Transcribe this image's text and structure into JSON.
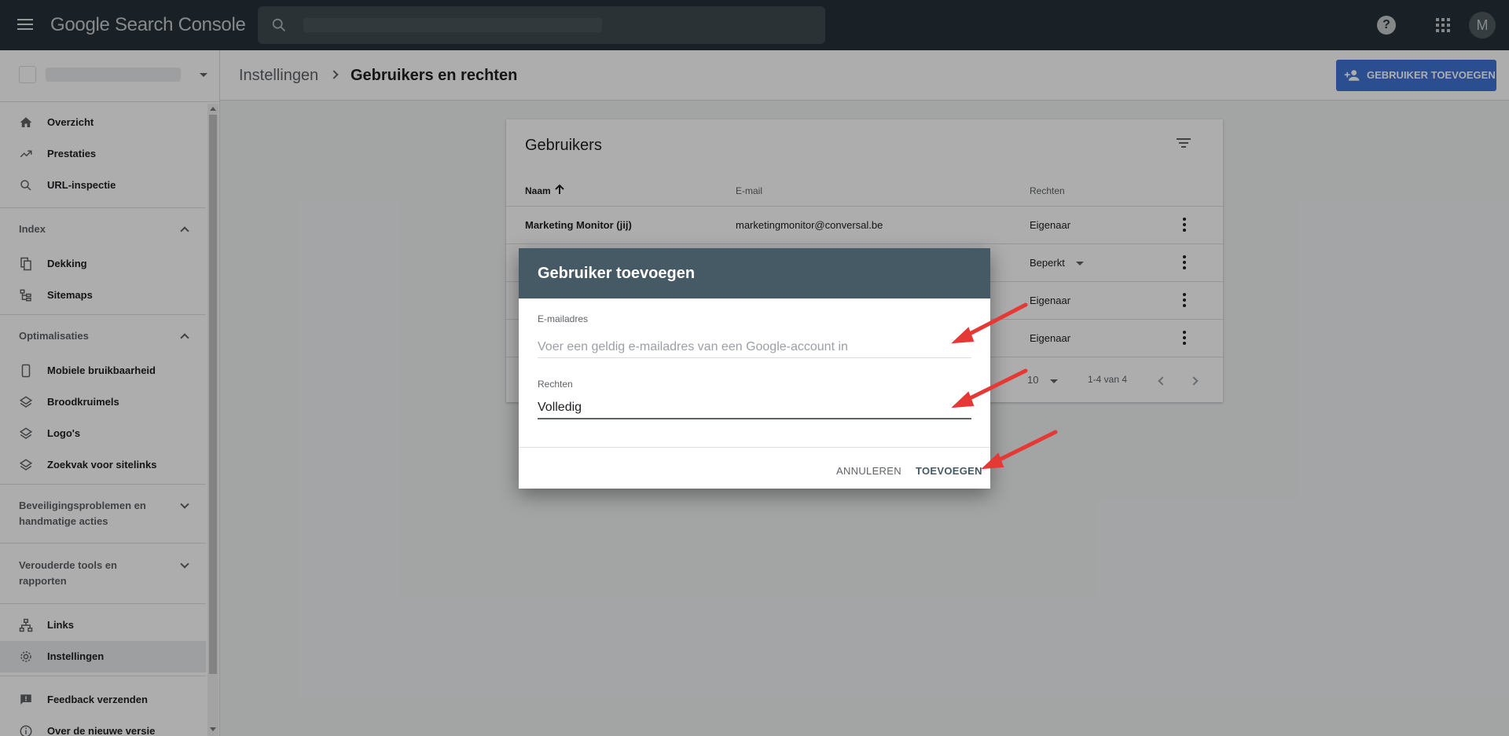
{
  "app": {
    "title": "Google Search Console",
    "avatar_letter": "M",
    "search_placeholder": ""
  },
  "sidebar": {
    "nav_top": [
      {
        "label": "Overzicht",
        "icon": "home-icon"
      },
      {
        "label": "Prestaties",
        "icon": "trending-up-icon"
      },
      {
        "label": "URL-inspectie",
        "icon": "search-icon"
      }
    ],
    "section_index": {
      "label": "Index",
      "items": [
        {
          "label": "Dekking",
          "icon": "copy-pages-icon"
        },
        {
          "label": "Sitemaps",
          "icon": "sitemap-icon"
        }
      ]
    },
    "section_opt": {
      "label": "Optimalisaties",
      "items": [
        {
          "label": "Mobiele bruikbaarheid",
          "icon": "phone-icon"
        },
        {
          "label": "Broodkruimels",
          "icon": "layers-icon"
        },
        {
          "label": "Logo's",
          "icon": "layers-icon"
        },
        {
          "label": "Zoekvak voor sitelinks",
          "icon": "layers-icon"
        }
      ]
    },
    "section_security": {
      "line1": "Beveiligingsproblemen en",
      "line2": "handmatige acties"
    },
    "section_legacy": {
      "line1": "Verouderde tools en",
      "line2": "rapporten"
    },
    "nav_bottom": [
      {
        "label": "Links",
        "icon": "links-icon"
      },
      {
        "label": "Instellingen",
        "icon": "gear-icon",
        "active": true
      }
    ],
    "nav_footer": [
      {
        "label": "Feedback verzenden",
        "icon": "feedback-icon"
      },
      {
        "label": "Over de nieuwe versie",
        "icon": "info-icon"
      }
    ]
  },
  "header": {
    "crumb_parent": "Instellingen",
    "crumb_current": "Gebruikers en rechten",
    "add_user_label": "GEBRUIKER TOEVOEGEN"
  },
  "users_card": {
    "title": "Gebruikers",
    "columns": {
      "name": "Naam",
      "email": "E-mail",
      "permission": "Rechten"
    },
    "rows": [
      {
        "name": "Marketing Monitor (jij)",
        "email": "marketingmonitor@conversal.be",
        "permission": "Eigenaar"
      },
      {
        "name": "",
        "email": "",
        "permission": "Beperkt"
      },
      {
        "name": "",
        "email": "",
        "permission": "Eigenaar"
      },
      {
        "name": "",
        "email": "",
        "permission": "Eigenaar"
      }
    ],
    "pager": {
      "rows_per_page": "10",
      "range": "1-4 van 4"
    }
  },
  "dialog": {
    "title": "Gebruiker toevoegen",
    "email_label": "E-mailadres",
    "email_placeholder": "Voer een geldig e-mailadres van een Google-account in",
    "email_value": "",
    "permission_label": "Rechten",
    "permission_value": "Volledig",
    "cancel_label": "ANNULEREN",
    "add_label": "TOEVOEGEN"
  },
  "colors": {
    "topbar": "#263238",
    "dialog_header": "#455a64",
    "primary_button": "#4074d6",
    "annotation_arrow": "#e53935"
  }
}
